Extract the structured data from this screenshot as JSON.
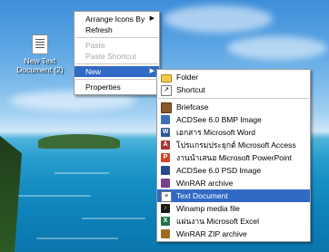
{
  "desktop": {
    "icon_label": "New Text Document (2)"
  },
  "context_menu": {
    "items": [
      {
        "label": "Arrange Icons By",
        "has_submenu": true
      },
      {
        "label": "Refresh"
      },
      {
        "label": "Paste",
        "disabled": true
      },
      {
        "label": "Paste Shortcut",
        "disabled": true
      },
      {
        "label": "New",
        "has_submenu": true,
        "selected": true
      },
      {
        "label": "Properties"
      }
    ],
    "arrow_glyph": "▶"
  },
  "new_submenu": {
    "items": [
      {
        "label": "Folder",
        "icon": "folder-icon"
      },
      {
        "label": "Shortcut",
        "icon": "shortcut-icon"
      },
      {
        "label": "Briefcase",
        "icon": "briefcase-icon"
      },
      {
        "label": "ACDSee 6.0 BMP Image",
        "icon": "bmp-image-icon"
      },
      {
        "label": "เอกสาร Microsoft Word",
        "icon": "word-document-icon"
      },
      {
        "label": "โปรแกรมประยุกต์ Microsoft Access",
        "icon": "access-database-icon"
      },
      {
        "label": "งานนำเสนอ Microsoft PowerPoint",
        "icon": "powerpoint-presentation-icon"
      },
      {
        "label": "ACDSee 6.0 PSD Image",
        "icon": "psd-image-icon"
      },
      {
        "label": "WinRAR archive",
        "icon": "winrar-archive-icon"
      },
      {
        "label": "Text Document",
        "icon": "text-document-icon",
        "selected": true
      },
      {
        "label": "Winamp media file",
        "icon": "winamp-media-icon"
      },
      {
        "label": "แผ่นงาน Microsoft Excel",
        "icon": "excel-worksheet-icon"
      },
      {
        "label": "WinRAR ZIP archive",
        "icon": "winrar-zip-icon"
      }
    ]
  },
  "colors": {
    "selection": "#316ac5",
    "disabled_text": "#a7a7a7"
  }
}
